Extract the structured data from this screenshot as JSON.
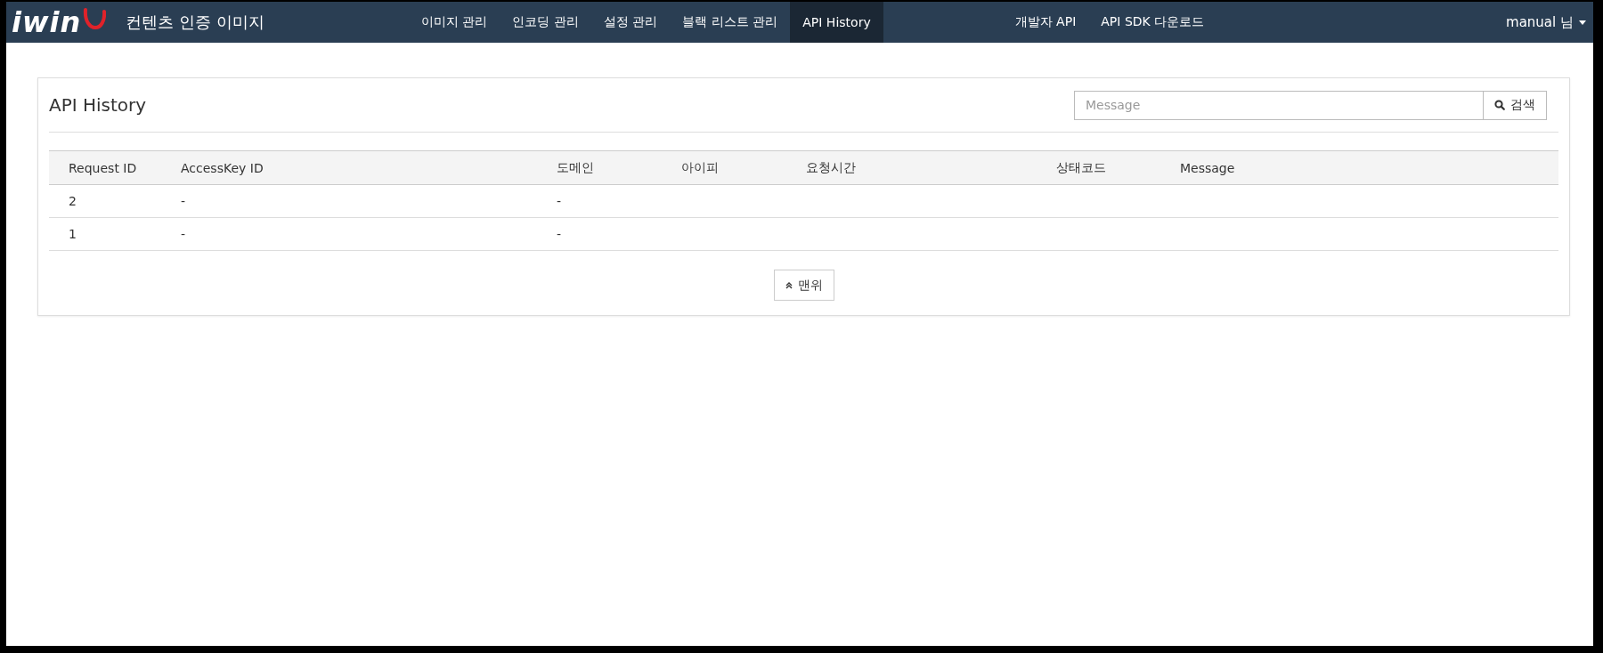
{
  "navbar": {
    "logo": "iwin",
    "title": "컨텐츠 인증 이미지",
    "menu": [
      {
        "label": "이미지 관리",
        "selected": false
      },
      {
        "label": "인코딩 관리",
        "selected": false
      },
      {
        "label": "설정 관리",
        "selected": false
      },
      {
        "label": "블랙 리스트 관리",
        "selected": false
      },
      {
        "label": "API History",
        "selected": true
      }
    ],
    "links": [
      "개발자 API",
      "API SDK 다운로드"
    ],
    "user": "manual 님"
  },
  "panel": {
    "title": "API History",
    "search": {
      "placeholder": "Message",
      "button": "검색"
    },
    "table": {
      "columns": [
        "Request ID",
        "AccessKey ID",
        "도메인",
        "아이피",
        "요청시간",
        "상태코드",
        "Message"
      ],
      "rows": [
        {
          "cells": [
            "2",
            "-",
            "-"
          ]
        },
        {
          "cells": [
            "1",
            "-",
            "-"
          ]
        }
      ]
    },
    "top_button": "맨위"
  }
}
